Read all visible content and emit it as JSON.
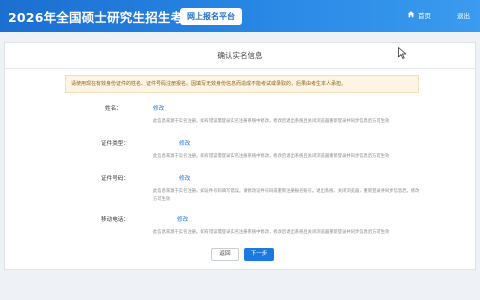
{
  "header": {
    "site_title": "2026年全国硕士研究生招生考试",
    "platform_badge": "网上报名平台",
    "home_label": "首页",
    "logout_label": "退出"
  },
  "card": {
    "title": "确认实名信息",
    "notice": "请使用现在有效身份证件的姓名、证件号码注册报名。因填写无效身份信息而造成不能考试或录取的，后果由考生本人承担。"
  },
  "fields": [
    {
      "label": "姓名：",
      "edit": "修改",
      "note": "此信息来源于实名注册。如有错误需登录实名注册系统中修改，修改后退出系统且关闭浏览器重新登录并同步信息后方可生效"
    },
    {
      "label": "证件类型：",
      "edit": "修改",
      "note": "此信息来源于实名注册。如有错误需登录实名注册系统中修改，修改后退出系统且关闭浏览器重新登录并同步信息后方可生效"
    },
    {
      "label": "证件号码：",
      "edit": "修改",
      "note": "此信息来源于实名注册。如证件号码填写错误，请修改证件号码或重新注册报名账号。退出系统、关闭浏览器，重新登录并同步信息后，修改方可生效"
    },
    {
      "label": "移动电话：",
      "edit": "修改",
      "note": "此信息来源于实名注册。如有错误需登录实名注册系统中修改，修改后退出系统且关闭浏览器重新登录并同步信息后方可生效"
    }
  ],
  "buttons": {
    "back": "返回",
    "next": "下一步"
  },
  "colors": {
    "header_blue": "#1b6fd1",
    "link_blue": "#1a73e8",
    "notice_bg": "#fdf4e3"
  },
  "icons": [
    "home-icon",
    "mouse-cursor-icon"
  ]
}
